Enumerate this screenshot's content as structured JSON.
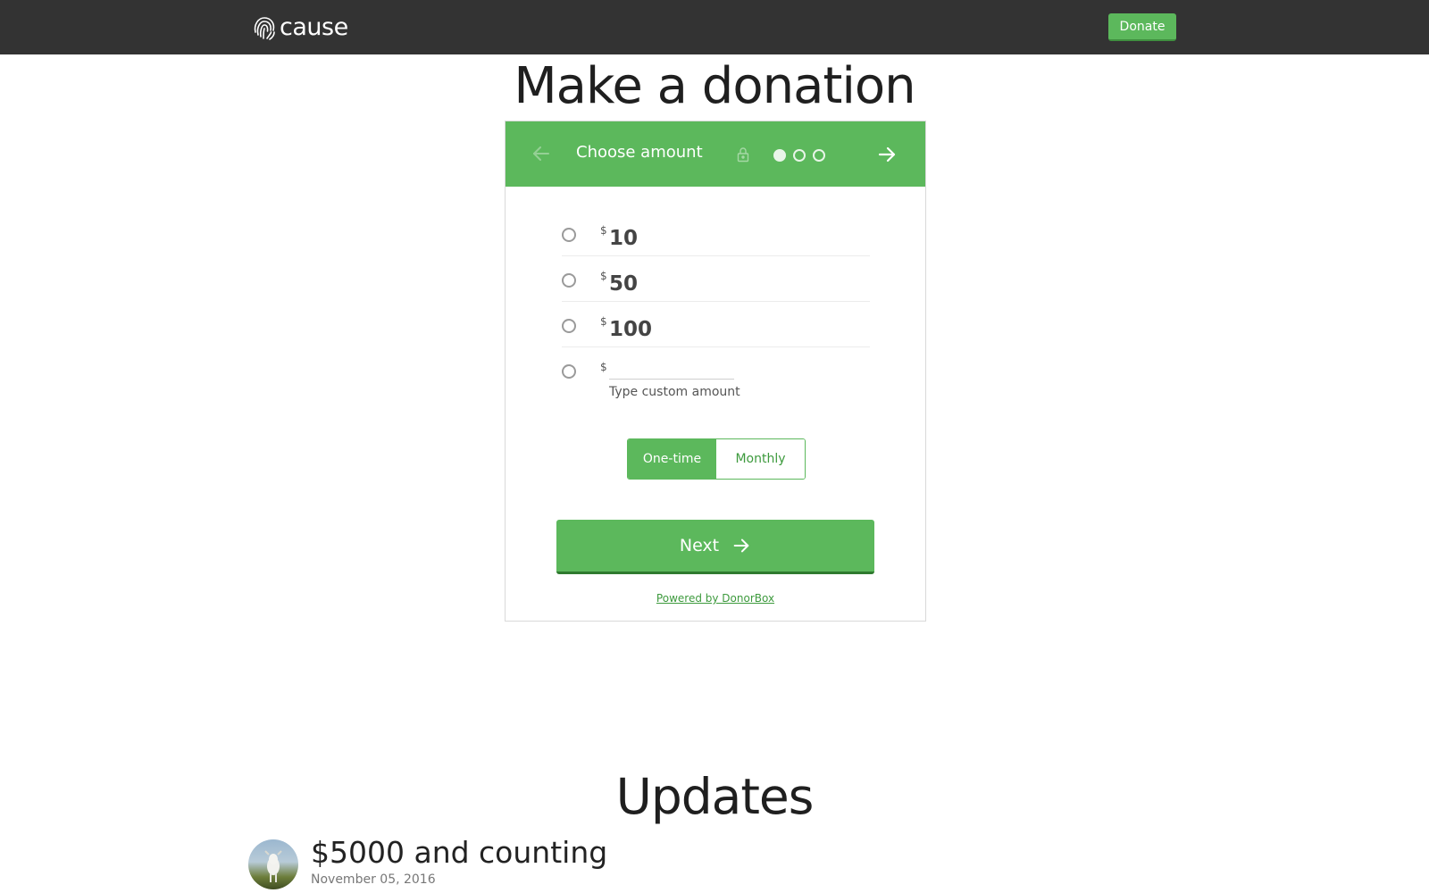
{
  "nav": {
    "logo_text": "cause",
    "donate_label": "Donate"
  },
  "page_title": "Make a donation",
  "widget": {
    "header_title": "Choose amount",
    "step_total": 3,
    "step_current": 1,
    "amounts": [
      {
        "currency": "$",
        "value": "10"
      },
      {
        "currency": "$",
        "value": "50"
      },
      {
        "currency": "$",
        "value": "100"
      }
    ],
    "custom": {
      "currency": "$",
      "value": "",
      "hint": "Type custom amount"
    },
    "frequency": {
      "one_time": "One-time",
      "monthly": "Monthly",
      "selected": "One-time"
    },
    "next_label": "Next",
    "powered_by": "Powered by DonorBox"
  },
  "updates": {
    "title": "Updates",
    "items": [
      {
        "title": "$5000 and counting",
        "date": "November 05, 2016"
      }
    ]
  },
  "colors": {
    "nav_bg": "#333333",
    "accent": "#5cb85c"
  }
}
